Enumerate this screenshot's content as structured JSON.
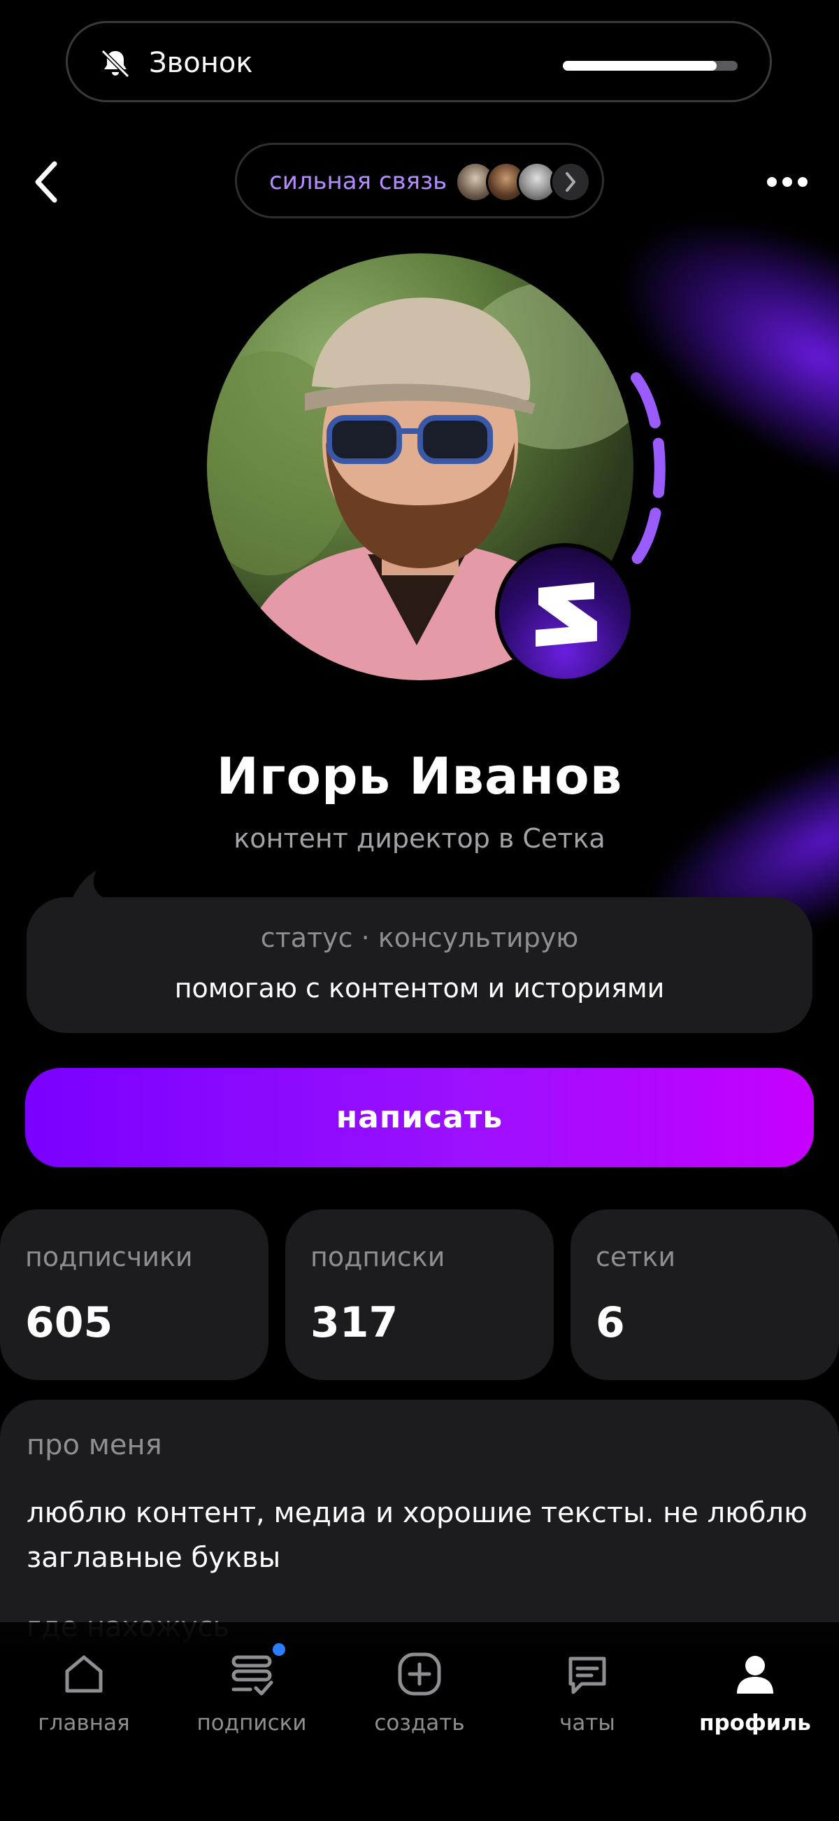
{
  "call_banner": {
    "title": "Звонок",
    "progress": 0.88
  },
  "nav": {
    "connection_label": "сильная связь"
  },
  "profile": {
    "name": "Игорь Иванов",
    "role": "контент директор в Сетка",
    "status_title": "статус · консультирую",
    "status_text": "помогаю с контентом и историями",
    "write_button": "написать"
  },
  "stats": [
    {
      "label": "подписчики",
      "value": "605"
    },
    {
      "label": "подписки",
      "value": "317"
    },
    {
      "label": "сетки",
      "value": "6"
    }
  ],
  "about": {
    "header": "про меня",
    "text": "люблю контент, медиа и хорошие тексты. не люблю заглавные буквы",
    "next_header": "где нахожусь"
  },
  "tabs": [
    {
      "label": "главная",
      "icon": "home-icon"
    },
    {
      "label": "подписки",
      "icon": "subscriptions-icon"
    },
    {
      "label": "создать",
      "icon": "create-icon"
    },
    {
      "label": "чаты",
      "icon": "chats-icon"
    },
    {
      "label": "профиль",
      "icon": "profile-icon"
    }
  ],
  "colors": {
    "accent": "#8a10ff",
    "card": "#1c1c1e",
    "muted": "#8e8e93",
    "connection": "#b48cff"
  }
}
